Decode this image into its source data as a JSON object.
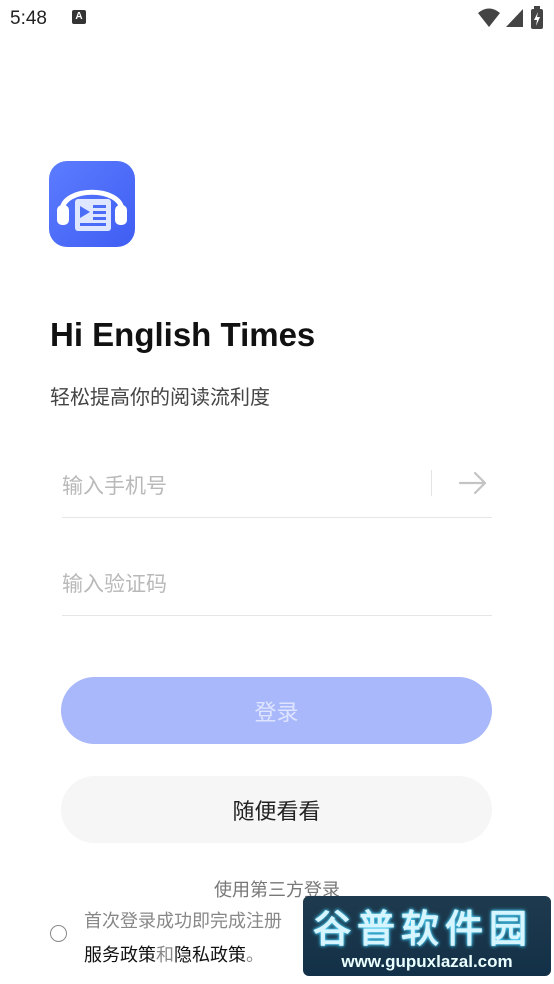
{
  "status_bar": {
    "time": "5:48",
    "notification_badge": "A"
  },
  "app": {
    "title": "Hi English Times",
    "subtitle": "轻松提高你的阅读流利度",
    "icon": "headphones-reading-icon",
    "brand_color": "#4a6cf7"
  },
  "form": {
    "phone_placeholder": "输入手机号",
    "phone_value": "",
    "code_placeholder": "输入验证码",
    "code_value": ""
  },
  "buttons": {
    "login": "登录",
    "browse": "随便看看"
  },
  "third_party_login": "使用第三方登录",
  "agreement": {
    "text_start": "首次登录成功即完成注册",
    "service_policy": "服务政策",
    "connector": "和",
    "privacy_policy": "隐私政策",
    "text_end": "。"
  },
  "watermark": {
    "title": "谷普软件园",
    "url": "www.gupuxlazal.com"
  }
}
